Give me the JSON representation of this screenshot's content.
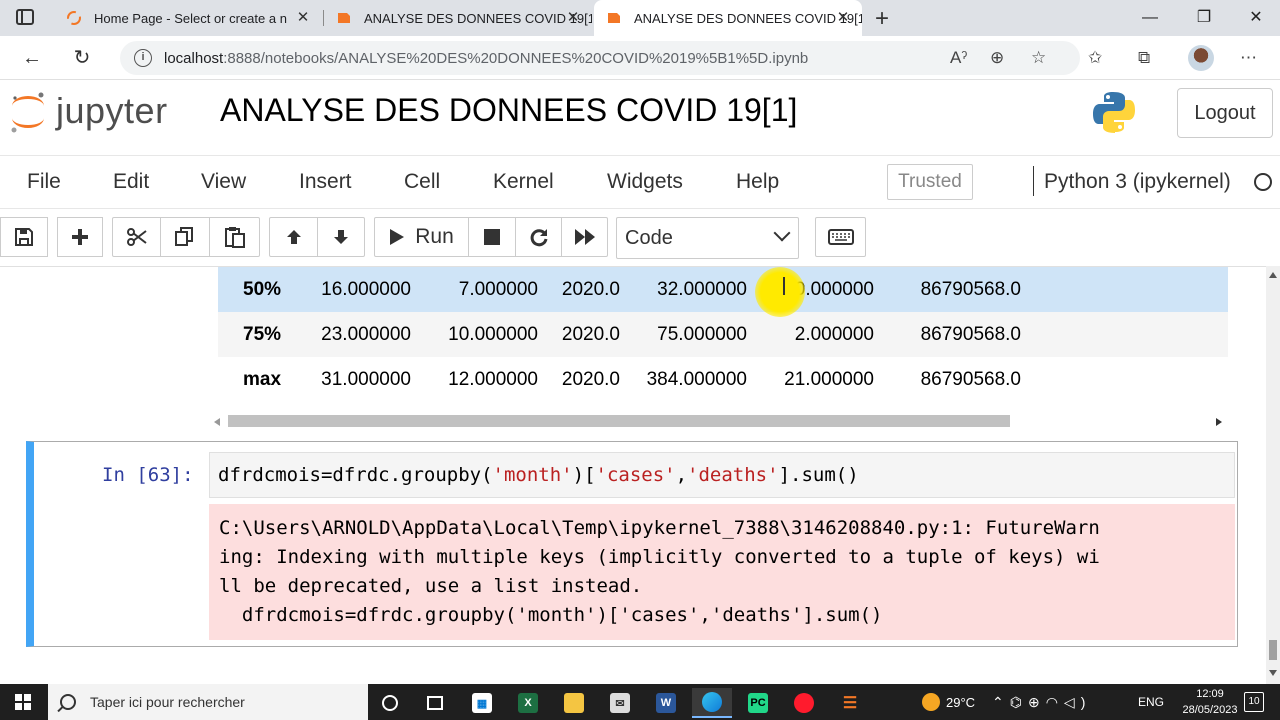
{
  "browser": {
    "tabs": [
      {
        "title": "Home Page - Select or create a n",
        "active": false
      },
      {
        "title": "ANALYSE DES DONNEES COVID 19[1",
        "active": false
      },
      {
        "title": "ANALYSE DES DONNEES COVID 19[1",
        "active": true
      }
    ],
    "url_host": "localhost",
    "url_path": ":8888/notebooks/ANALYSE%20DES%20DONNEES%20COVID%2019%5B1%5D.ipynb"
  },
  "jupyter": {
    "brand": "jupyter",
    "notebook_title": "ANALYSE DES DONNEES COVID 19[1]",
    "logout_label": "Logout",
    "menu": [
      "File",
      "Edit",
      "View",
      "Insert",
      "Cell",
      "Kernel",
      "Widgets",
      "Help"
    ],
    "trusted_label": "Trusted",
    "kernel_name": "Python 3 (ipykernel)",
    "toolbar": {
      "run_label": "Run",
      "cell_type": "Code"
    }
  },
  "dataframe": {
    "rows": [
      {
        "index": "50%",
        "values": [
          "16.000000",
          "7.000000",
          "2020.0",
          "32.000000",
          "0.000000",
          "86790568.0"
        ]
      },
      {
        "index": "75%",
        "values": [
          "23.000000",
          "10.000000",
          "2020.0",
          "75.000000",
          "2.000000",
          "86790568.0"
        ]
      },
      {
        "index": "max",
        "values": [
          "31.000000",
          "12.000000",
          "2020.0",
          "384.000000",
          "21.000000",
          "86790568.0"
        ]
      }
    ]
  },
  "cell": {
    "prompt": "In [63]:",
    "code_parts": [
      "dfrdcmois=dfrdc.groupby(",
      "'month'",
      ")[",
      "'cases'",
      ",",
      "'deaths'",
      "].sum()"
    ],
    "stderr_lines": [
      "C:\\Users\\ARNOLD\\AppData\\Local\\Temp\\ipykernel_7388\\3146208840.py:1: FutureWarn",
      "ing: Indexing with multiple keys (implicitly converted to a tuple of keys) wi",
      "ll be deprecated, use a list instead.",
      "  dfrdcmois=dfrdc.groupby('month')['cases','deaths'].sum()"
    ]
  },
  "taskbar": {
    "search_placeholder": "Taper ici pour rechercher",
    "weather": "29°C",
    "language": "ENG",
    "time": "12:09",
    "date": "28/05/2023",
    "notification_count": "10"
  },
  "colors": {
    "cell_selected_border": "#42a5f5",
    "stderr_bg": "#fddede",
    "prompt_color": "#303f9f",
    "string_color": "#ba2121",
    "highlight_row": "#cfe4f7"
  }
}
